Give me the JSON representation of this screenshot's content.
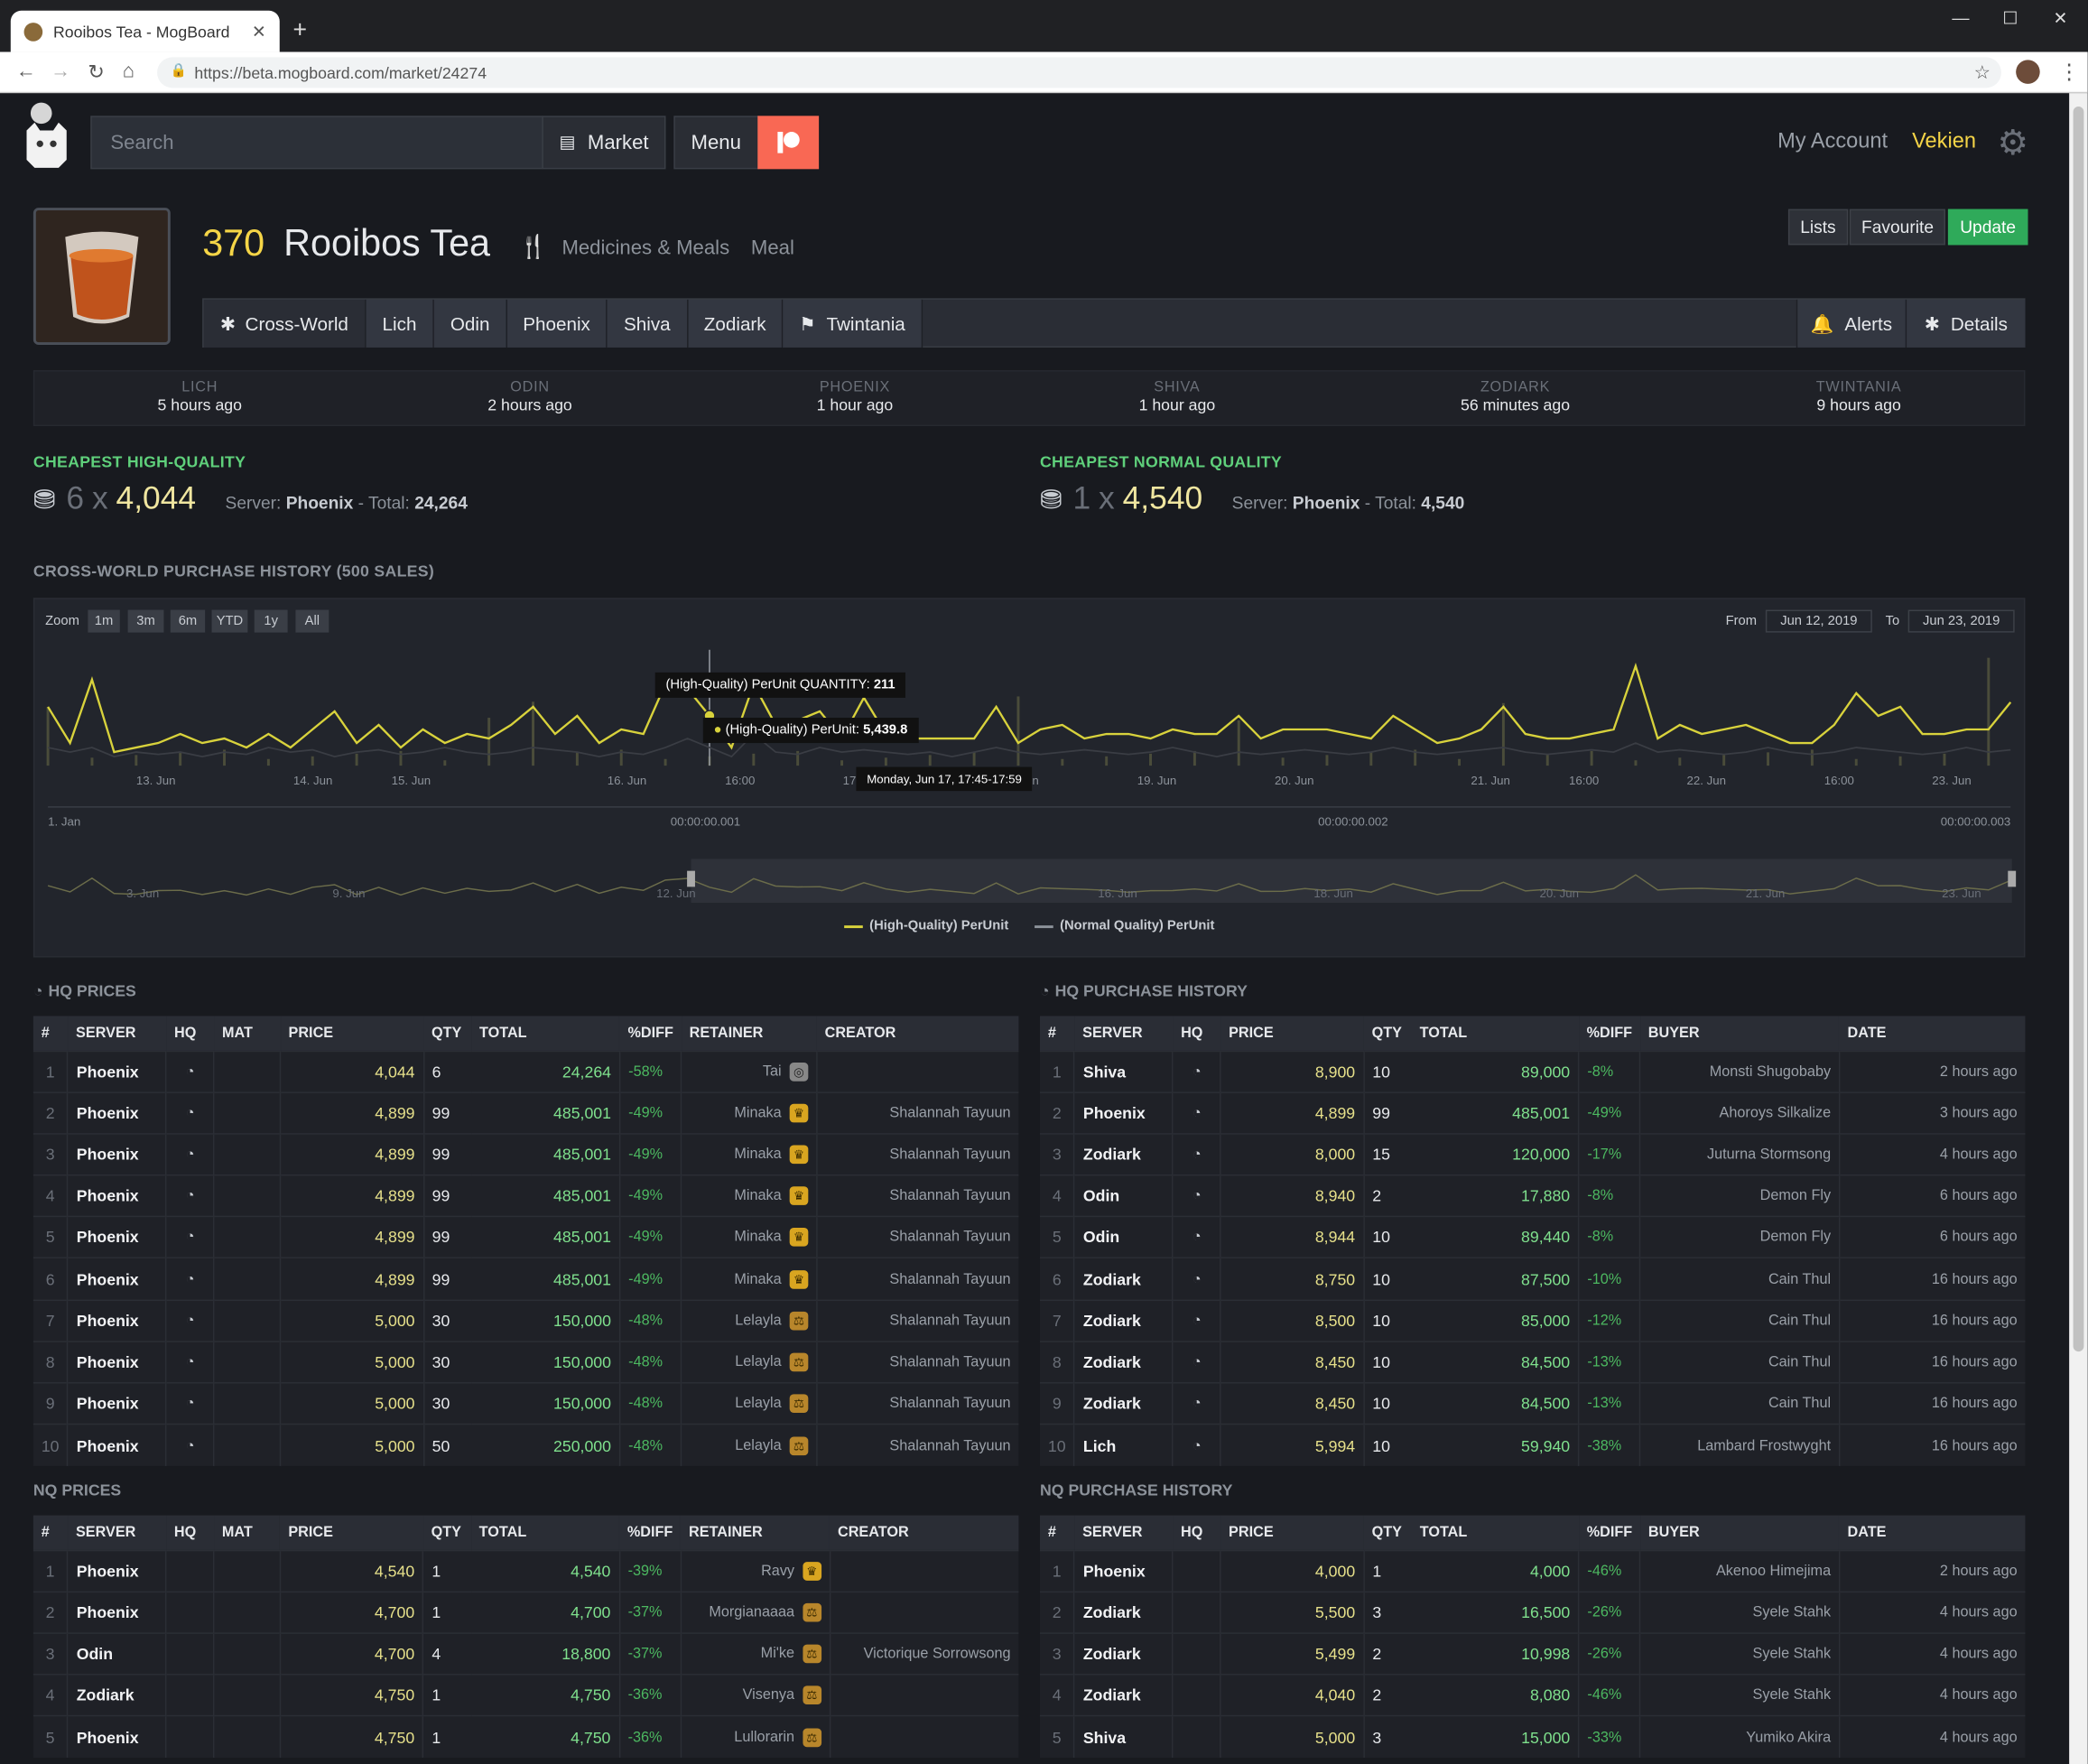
{
  "browser": {
    "tab_title": "Rooibos Tea - MogBoard",
    "new_tab": "+",
    "url": "https://beta.mogboard.com/market/24274"
  },
  "header": {
    "search_placeholder": "Search",
    "market": "Market",
    "menu": "Menu",
    "my_account": "My Account",
    "user": "Vekien"
  },
  "item": {
    "level": "370",
    "name": "Rooibos Tea",
    "category": "Medicines & Meals",
    "type": "Meal",
    "actions": [
      "Lists",
      "Favourite",
      "Update"
    ],
    "worlds": [
      "Cross-World",
      "Lich",
      "Odin",
      "Phoenix",
      "Shiva",
      "Zodiark",
      "Twintania"
    ],
    "right_tabs": [
      "Alerts",
      "Details"
    ]
  },
  "updates": [
    {
      "world": "LICH",
      "ago": "5 hours ago"
    },
    {
      "world": "ODIN",
      "ago": "2 hours ago"
    },
    {
      "world": "PHOENIX",
      "ago": "1 hour ago"
    },
    {
      "world": "SHIVA",
      "ago": "1 hour ago"
    },
    {
      "world": "ZODIARK",
      "ago": "56 minutes ago"
    },
    {
      "world": "TWINTANIA",
      "ago": "9 hours ago"
    }
  ],
  "cheapest": {
    "hq": {
      "label": "CHEAPEST HIGH-QUALITY",
      "qty": "6",
      "x": "x",
      "price": "4,044",
      "server_label": "Server:",
      "server": "Phoenix",
      "total_label": "- Total:",
      "total": "24,264"
    },
    "nq": {
      "label": "CHEAPEST NORMAL QUALITY",
      "qty": "1",
      "x": "x",
      "price": "4,540",
      "server_label": "Server:",
      "server": "Phoenix",
      "total_label": "- Total:",
      "total": "4,540"
    }
  },
  "history_title": "CROSS-WORLD PURCHASE HISTORY (500 SALES)",
  "chart_ui": {
    "zoom_label": "Zoom",
    "zoom_buttons": [
      "1m",
      "3m",
      "6m",
      "YTD",
      "1y",
      "All"
    ],
    "from_label": "From",
    "from": "Jun 12, 2019",
    "to_label": "To",
    "to": "Jun 23, 2019",
    "tooltip_qty_label": "(High-Quality) PerUnit QUANTITY:",
    "tooltip_qty": "211",
    "tooltip_price_label": "(High-Quality) PerUnit:",
    "tooltip_price": "5,439.8",
    "tooltip_date": "Monday, Jun 17, 17:45-17:59",
    "nav_axis": [
      "1. Jan",
      "00:00:00.001",
      "00:00:00.002",
      "00:00:00.003"
    ],
    "nav_dates": [
      "3. Jun",
      "9. Jun",
      "12. Jun",
      "16. Jun",
      "18. Jun",
      "20. Jun",
      "21. Jun",
      "23. Jun"
    ]
  },
  "chart_data": {
    "type": "line",
    "x_tick_labels": [
      "13. Jun",
      "14. Jun",
      "15. Jun",
      "16. Jun",
      "16:00",
      "17. Jun",
      "Jun",
      "19. Jun",
      "20. Jun",
      "21. Jun",
      "16:00",
      "22. Jun",
      "16:00",
      "23. Jun"
    ],
    "series": [
      {
        "name": "(High-Quality) PerUnit",
        "color": "#d8d23c",
        "values": [
          5800,
          5000,
          6400,
          4800,
          4900,
          5000,
          5200,
          5000,
          5100,
          4900,
          5200,
          4900,
          5300,
          5700,
          5000,
          5400,
          4900,
          5300,
          5000,
          5200,
          5100,
          5400,
          5800,
          5200,
          5600,
          5000,
          5300,
          5200,
          6300,
          6200,
          5600,
          4900,
          6300,
          5400,
          5500,
          5700,
          5100,
          6000,
          5200,
          5100,
          5100,
          5100,
          5100,
          5800,
          5000,
          5300,
          5400,
          5100,
          5200,
          5200,
          5100,
          5300,
          5200,
          5200,
          5600,
          5100,
          5300,
          5300,
          5300,
          5200,
          5100,
          5600,
          5300,
          5000,
          5100,
          5300,
          5800,
          5200,
          5100,
          5100,
          5200,
          5300,
          6700,
          5100,
          5400,
          5200,
          5300,
          5400,
          5200,
          5000,
          5000,
          5400,
          6100,
          5600,
          5800,
          5200,
          5200,
          5300,
          5300,
          5900
        ]
      },
      {
        "name": "(Normal Quality) PerUnit",
        "color": "#55585f",
        "values": [
          4900,
          4800,
          4900,
          4700,
          4800,
          4750,
          4800,
          4700,
          4800,
          4750,
          4900,
          4800,
          4850,
          4700,
          4800,
          4850,
          4750,
          4800,
          4900,
          4800,
          4750,
          4800,
          4900,
          4850,
          4800,
          4700,
          4800,
          4750,
          4900,
          5100,
          4900,
          4700,
          5200,
          4800,
          4750,
          4900,
          4800,
          4850,
          4800,
          4750,
          4800,
          4700,
          4800,
          4900,
          4800,
          4750,
          4800,
          4850,
          4800,
          4750,
          4800,
          4900,
          4800,
          4700,
          4800,
          4750,
          4800,
          4850,
          4800,
          4750,
          4800,
          4900,
          4800,
          4750,
          4800,
          4850,
          4900,
          4800,
          4750,
          4800,
          4850,
          4800,
          5000,
          4800,
          4850,
          4800,
          4750,
          4800,
          4900,
          4800,
          4750,
          4800,
          4900,
          4850,
          4800,
          4750,
          4800,
          4900,
          4800,
          4850
        ]
      }
    ]
  },
  "hq_prices": {
    "title": "HQ PRICES",
    "headers": [
      "#",
      "SERVER",
      "HQ",
      "MAT",
      "PRICE",
      "QTY",
      "TOTAL",
      "%DIFF",
      "RETAINER",
      "CREATOR"
    ],
    "rows": [
      [
        "1",
        "Phoenix",
        "4,044",
        "6",
        "24,264",
        "-58%",
        "Tai",
        ""
      ],
      [
        "2",
        "Phoenix",
        "4,899",
        "99",
        "485,001",
        "-49%",
        "Minaka",
        "Shalannah Tayuun"
      ],
      [
        "3",
        "Phoenix",
        "4,899",
        "99",
        "485,001",
        "-49%",
        "Minaka",
        "Shalannah Tayuun"
      ],
      [
        "4",
        "Phoenix",
        "4,899",
        "99",
        "485,001",
        "-49%",
        "Minaka",
        "Shalannah Tayuun"
      ],
      [
        "5",
        "Phoenix",
        "4,899",
        "99",
        "485,001",
        "-49%",
        "Minaka",
        "Shalannah Tayuun"
      ],
      [
        "6",
        "Phoenix",
        "4,899",
        "99",
        "485,001",
        "-49%",
        "Minaka",
        "Shalannah Tayuun"
      ],
      [
        "7",
        "Phoenix",
        "5,000",
        "30",
        "150,000",
        "-48%",
        "Lelayla",
        "Shalannah Tayuun"
      ],
      [
        "8",
        "Phoenix",
        "5,000",
        "30",
        "150,000",
        "-48%",
        "Lelayla",
        "Shalannah Tayuun"
      ],
      [
        "9",
        "Phoenix",
        "5,000",
        "30",
        "150,000",
        "-48%",
        "Lelayla",
        "Shalannah Tayuun"
      ],
      [
        "10",
        "Phoenix",
        "5,000",
        "50",
        "250,000",
        "-48%",
        "Lelayla",
        "Shalannah Tayuun"
      ]
    ]
  },
  "hq_history": {
    "title": "HQ PURCHASE HISTORY",
    "headers": [
      "#",
      "SERVER",
      "HQ",
      "PRICE",
      "QTY",
      "TOTAL",
      "%DIFF",
      "BUYER",
      "DATE"
    ],
    "rows": [
      [
        "1",
        "Shiva",
        "8,900",
        "10",
        "89,000",
        "-8%",
        "Monsti Shugobaby",
        "2 hours ago"
      ],
      [
        "2",
        "Phoenix",
        "4,899",
        "99",
        "485,001",
        "-49%",
        "Ahoroys Silkalize",
        "3 hours ago"
      ],
      [
        "3",
        "Zodiark",
        "8,000",
        "15",
        "120,000",
        "-17%",
        "Juturna Stormsong",
        "4 hours ago"
      ],
      [
        "4",
        "Odin",
        "8,940",
        "2",
        "17,880",
        "-8%",
        "Demon Fly",
        "6 hours ago"
      ],
      [
        "5",
        "Odin",
        "8,944",
        "10",
        "89,440",
        "-8%",
        "Demon Fly",
        "6 hours ago"
      ],
      [
        "6",
        "Zodiark",
        "8,750",
        "10",
        "87,500",
        "-10%",
        "Cain Thul",
        "16 hours ago"
      ],
      [
        "7",
        "Zodiark",
        "8,500",
        "10",
        "85,000",
        "-12%",
        "Cain Thul",
        "16 hours ago"
      ],
      [
        "8",
        "Zodiark",
        "8,450",
        "10",
        "84,500",
        "-13%",
        "Cain Thul",
        "16 hours ago"
      ],
      [
        "9",
        "Zodiark",
        "8,450",
        "10",
        "84,500",
        "-13%",
        "Cain Thul",
        "16 hours ago"
      ],
      [
        "10",
        "Lich",
        "5,994",
        "10",
        "59,940",
        "-38%",
        "Lambard Frostwyght",
        "16 hours ago"
      ]
    ]
  },
  "nq_prices": {
    "title": "NQ PRICES",
    "headers": [
      "#",
      "SERVER",
      "HQ",
      "MAT",
      "PRICE",
      "QTY",
      "TOTAL",
      "%DIFF",
      "RETAINER",
      "CREATOR"
    ],
    "rows": [
      [
        "1",
        "Phoenix",
        "4,540",
        "1",
        "4,540",
        "-39%",
        "Ravy",
        ""
      ],
      [
        "2",
        "Phoenix",
        "4,700",
        "1",
        "4,700",
        "-37%",
        "Morgianaaaa",
        ""
      ],
      [
        "3",
        "Odin",
        "4,700",
        "4",
        "18,800",
        "-37%",
        "Mi'ke",
        "Victorique Sorrowsong"
      ],
      [
        "4",
        "Zodiark",
        "4,750",
        "1",
        "4,750",
        "-36%",
        "Visenya",
        ""
      ],
      [
        "5",
        "Phoenix",
        "4,750",
        "1",
        "4,750",
        "-36%",
        "Lullorarin",
        ""
      ]
    ]
  },
  "nq_history": {
    "title": "NQ PURCHASE HISTORY",
    "headers": [
      "#",
      "SERVER",
      "HQ",
      "PRICE",
      "QTY",
      "TOTAL",
      "%DIFF",
      "BUYER",
      "DATE"
    ],
    "rows": [
      [
        "1",
        "Phoenix",
        "4,000",
        "1",
        "4,000",
        "-46%",
        "Akenoo Himejima",
        "2 hours ago"
      ],
      [
        "2",
        "Zodiark",
        "5,500",
        "3",
        "16,500",
        "-26%",
        "Syele Stahk",
        "4 hours ago"
      ],
      [
        "3",
        "Zodiark",
        "5,499",
        "2",
        "10,998",
        "-26%",
        "Syele Stahk",
        "4 hours ago"
      ],
      [
        "4",
        "Zodiark",
        "4,040",
        "2",
        "8,080",
        "-46%",
        "Syele Stahk",
        "4 hours ago"
      ],
      [
        "5",
        "Shiva",
        "5,000",
        "3",
        "15,000",
        "-33%",
        "Yumiko Akira",
        "4 hours ago"
      ]
    ]
  }
}
